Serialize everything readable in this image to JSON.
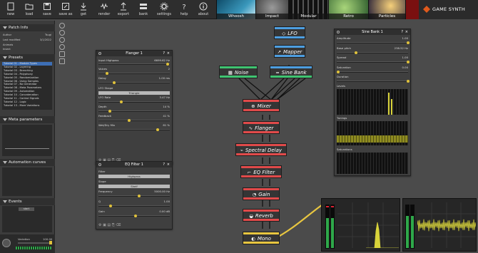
{
  "toolbar": {
    "buttons": [
      {
        "label": "new",
        "icon": "file-new-icon"
      },
      {
        "label": "load",
        "icon": "folder-open-icon"
      },
      {
        "label": "save",
        "icon": "save-icon"
      },
      {
        "label": "save as",
        "icon": "save-as-icon"
      },
      {
        "label": "get",
        "icon": "download-icon"
      },
      {
        "label": "render",
        "icon": "render-icon"
      },
      {
        "label": "export",
        "icon": "export-icon"
      },
      {
        "label": "bank",
        "icon": "bank-icon"
      },
      {
        "label": "settings",
        "icon": "gear-icon"
      },
      {
        "label": "help",
        "icon": "help-icon"
      },
      {
        "label": "about",
        "icon": "info-icon"
      }
    ],
    "presets": [
      {
        "label": "Whoosh",
        "color": "#1c6a8a"
      },
      {
        "label": "Impact",
        "color": "#6b6b6b"
      },
      {
        "label": "Modular",
        "color": "#2d2d2d"
      },
      {
        "label": "Retro",
        "color": "#2e4d2e"
      },
      {
        "label": "Particles",
        "color": "#131323"
      }
    ],
    "brand": "GAME SYNTH"
  },
  "sidebar": {
    "patch_info": {
      "title": "Patch Info",
      "rows": [
        {
          "key": "Author",
          "value": "Tsugi"
        },
        {
          "key": "Last modified",
          "value": "3/1/2022"
        },
        {
          "key": "Animals",
          "value": ""
        },
        {
          "key": "Insect",
          "value": ""
        }
      ]
    },
    "presets": {
      "title": "Presets",
      "items": [
        "Tutorial 01 - Module Types",
        "Tutorial 02 - Layering",
        "Tutorial 03 - Branching",
        "Tutorial 04 - Polyphony",
        "Tutorial 05 - Randomization",
        "Tutorial 06 - Using Samples",
        "Tutorial 07 - No Generator",
        "Tutorial 08 - Meta Parameters",
        "Tutorial 09 - Automation",
        "Tutorial 10 - Concatenation",
        "Tutorial 11 - Control Signals",
        "Tutorial 12 - Logic",
        "Tutorial 13 - More Variations"
      ],
      "selected_index": 0
    },
    "meta_parameters": {
      "title": "Meta parameters"
    },
    "automation_curves": {
      "title": "Automation curves"
    },
    "events": {
      "title": "Events",
      "items": [
        "start"
      ]
    },
    "variation": {
      "label": "Variation",
      "value": "100.00"
    }
  },
  "flanger": {
    "title": "Flanger 1",
    "input_label": "Input Highpass",
    "input_value": "6699.62 Hz",
    "params": [
      {
        "label": "Voices",
        "value": "2",
        "level": 0.1
      },
      {
        "label": "Delay",
        "value": "1.00 ms",
        "level": 0.2
      },
      {
        "label": "LFO Shape",
        "value": "",
        "level": null
      },
      {
        "label": "LFO Rate",
        "value": "3.47 Hz",
        "level": 0.3
      },
      {
        "label": "Depth",
        "value": "14 %",
        "level": 0.14
      },
      {
        "label": "Feedback",
        "value": "41 %",
        "level": 0.41
      },
      {
        "label": "Wet/Dry Mix",
        "value": "81 %",
        "level": 0.81
      }
    ],
    "lfo_shape": "Triangle"
  },
  "eq": {
    "title": "EQ Filter 1",
    "filter_label": "Filter",
    "filter_value": "Highpass",
    "slope_label": "Slope",
    "slope_value": "Shelf",
    "params": [
      {
        "label": "Frequency",
        "value": "5000.00 Hz",
        "level": 0.55
      },
      {
        "label": "Q",
        "value": "1.00",
        "level": 0.15
      },
      {
        "label": "Gain",
        "value": "0.00 dB",
        "level": 0.5
      }
    ]
  },
  "sine": {
    "title": "Sine Bank 1",
    "params": [
      {
        "label": "Amplitude",
        "value": "1.00",
        "level": 1.0
      },
      {
        "label": "Base pitch",
        "value": "238.52 Hz",
        "level": 0.25
      },
      {
        "label": "Spread",
        "value": "1.00",
        "level": 1.0
      },
      {
        "label": "Saturation",
        "value": "0.00",
        "level": 0.0
      },
      {
        "label": "Duration",
        "value": "",
        "level": 1.0
      }
    ],
    "curves": [
      "Levels",
      "Tunings",
      "Saturations"
    ]
  },
  "nodes": [
    {
      "id": "lfo",
      "label": "LFO",
      "glyph": "◇",
      "top": "#4d9ee0",
      "bottom": "#4d9ee0"
    },
    {
      "id": "mapper",
      "label": "Mapper",
      "glyph": "↗",
      "top": "#4d9ee0",
      "bottom": "#4d9ee0"
    },
    {
      "id": "noise",
      "label": "Noise",
      "glyph": "▦",
      "top": "#3fc471",
      "bottom": "#3fc471"
    },
    {
      "id": "sinebank",
      "label": "Sine Bank",
      "glyph": "≈",
      "top": "#4d9ee0",
      "bottom": "#3fc471"
    },
    {
      "id": "mixer",
      "label": "Mixer",
      "glyph": "⊕",
      "top": "#e04a4a",
      "bottom": "#e04a4a"
    },
    {
      "id": "flanger",
      "label": "Flanger",
      "glyph": "∿",
      "top": "#e04a4a",
      "bottom": "#e04a4a"
    },
    {
      "id": "spectral",
      "label": "Spectral Delay",
      "glyph": "⌁",
      "top": "#e04a4a",
      "bottom": "#e04a4a"
    },
    {
      "id": "eqf",
      "label": "EQ Filter",
      "glyph": "⌐",
      "top": "#e04a4a",
      "bottom": "#e04a4a"
    },
    {
      "id": "gain",
      "label": "Gain",
      "glyph": "◔",
      "top": "#e04a4a",
      "bottom": "#e04a4a"
    },
    {
      "id": "reverb",
      "label": "Reverb",
      "glyph": "◒",
      "top": "#e04a4a",
      "bottom": "#e04a4a"
    },
    {
      "id": "mono",
      "label": "Mono",
      "glyph": "◐",
      "top": "#e8c640",
      "bottom": "#e8c640"
    }
  ],
  "colors": {
    "accent": "#e0c23b",
    "select": "#3d6fb6",
    "meter": "#2fa84a",
    "wave": "#d8d33a"
  }
}
